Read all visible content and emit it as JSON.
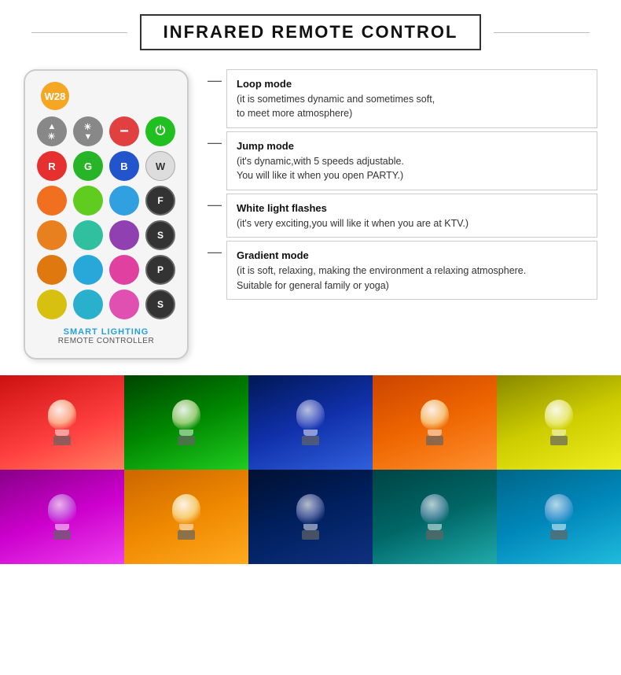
{
  "header": {
    "title": "INFRARED REMOTE CONTROL"
  },
  "remote": {
    "logo_text": "W28",
    "brand_label": "SMART LIGHTING",
    "sub_label": "REMOTE CONTROLLER",
    "rows": [
      {
        "type": "control",
        "buttons": [
          {
            "label": "▲☀",
            "class": "btn-gray",
            "name": "brightness-up"
          },
          {
            "label": "☀↓",
            "class": "btn-gray",
            "name": "brightness-down"
          },
          {
            "label": "−",
            "class": "btn-minus",
            "name": "minus-btn"
          },
          {
            "label": "⏻",
            "class": "btn-power-green",
            "name": "power-btn"
          }
        ]
      },
      {
        "type": "color",
        "buttons": [
          {
            "label": "R",
            "class": "btn-red",
            "name": "red-btn"
          },
          {
            "label": "G",
            "class": "btn-green",
            "name": "green-btn"
          },
          {
            "label": "B",
            "class": "btn-blue",
            "name": "blue-btn"
          },
          {
            "label": "W",
            "class": "btn-white",
            "name": "white-btn"
          }
        ]
      },
      {
        "type": "color",
        "buttons": [
          {
            "label": "",
            "class": "btn-orange",
            "name": "orange-btn"
          },
          {
            "label": "",
            "class": "btn-lime",
            "name": "lime-btn"
          },
          {
            "label": "",
            "class": "btn-sky",
            "name": "sky-btn"
          },
          {
            "label": "F",
            "class": "btn-dark-circle",
            "name": "f-btn"
          }
        ]
      },
      {
        "type": "color",
        "buttons": [
          {
            "label": "",
            "class": "btn-orange2",
            "name": "orange2-btn"
          },
          {
            "label": "",
            "class": "btn-teal",
            "name": "teal-btn"
          },
          {
            "label": "",
            "class": "btn-purple",
            "name": "purple-btn"
          },
          {
            "label": "S",
            "class": "btn-dark-circle",
            "name": "s1-btn"
          }
        ]
      },
      {
        "type": "color",
        "buttons": [
          {
            "label": "",
            "class": "btn-orange",
            "name": "orange3-btn"
          },
          {
            "label": "",
            "class": "btn-sky",
            "name": "sky2-btn"
          },
          {
            "label": "",
            "class": "btn-pink",
            "name": "pink-btn"
          },
          {
            "label": "P",
            "class": "btn-dark-circle",
            "name": "p-btn"
          }
        ]
      },
      {
        "type": "color",
        "buttons": [
          {
            "label": "",
            "class": "btn-yellow",
            "name": "yellow-btn"
          },
          {
            "label": "",
            "class": "btn-cyan",
            "name": "cyan-btn"
          },
          {
            "label": "",
            "class": "btn-pink",
            "name": "pink2-btn"
          },
          {
            "label": "S",
            "class": "btn-dark-circle",
            "name": "s2-btn"
          }
        ]
      }
    ]
  },
  "descriptions": [
    {
      "id": "loop-mode",
      "title": "Loop mode",
      "body": "(it is sometimes dynamic and sometimes soft,\nto meet more atmosphere)"
    },
    {
      "id": "jump-mode",
      "title": "Jump mode",
      "body": "(it's dynamic,with 5 speeds adjustable.\nYou will like it when you open PARTY.)"
    },
    {
      "id": "white-flash",
      "title": "White light flashes",
      "body": "(it's very exciting,you will like it when you are at KTV.)"
    },
    {
      "id": "gradient-mode",
      "title": "Gradient mode",
      "body": "(it is soft, relaxing, making the environment a relaxing atmosphere.\nSuitable for general family or yoga)"
    }
  ],
  "bulb_grid": {
    "row1": [
      {
        "bg": "bg-red",
        "name": "red-bulb"
      },
      {
        "bg": "bg-green",
        "name": "green-bulb"
      },
      {
        "bg": "bg-blue",
        "name": "blue-bulb"
      },
      {
        "bg": "bg-orange",
        "name": "orange-bulb"
      },
      {
        "bg": "bg-yellow",
        "name": "yellow-bulb"
      }
    ],
    "row2": [
      {
        "bg": "bg-magenta",
        "name": "magenta-bulb"
      },
      {
        "bg": "bg-amber",
        "name": "amber-bulb"
      },
      {
        "bg": "bg-dark-blue",
        "name": "dark-blue-bulb"
      },
      {
        "bg": "bg-teal",
        "name": "teal-bulb"
      },
      {
        "bg": "bg-cyan2",
        "name": "cyan-bulb"
      }
    ]
  }
}
